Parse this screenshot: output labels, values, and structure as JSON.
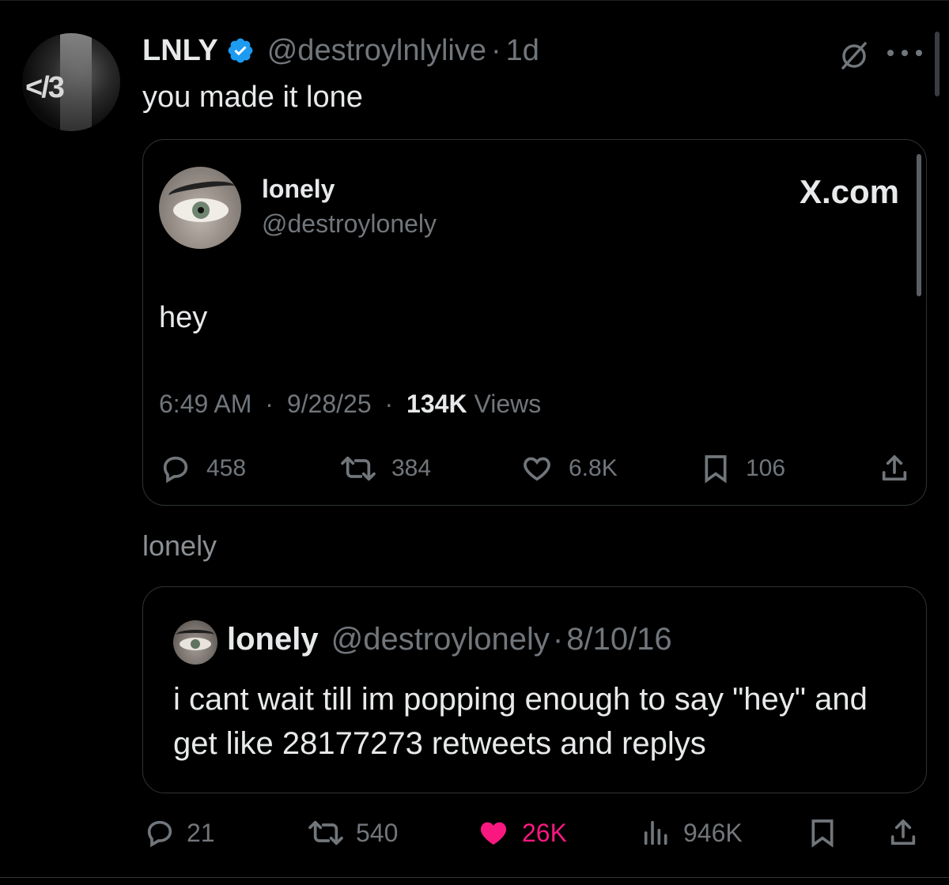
{
  "post": {
    "avatar_text": "</3",
    "author_name": "LNLY",
    "handle": "@destroylnlylive",
    "separator": "·",
    "time": "1d",
    "text": "you made it lone"
  },
  "quote_card": {
    "name": "lonely",
    "handle": "@destroylonely",
    "source": "X.com",
    "text": "hey",
    "time": "6:49 AM",
    "date": "9/28/25",
    "views_count": "134K",
    "views_label": "Views",
    "sep": "·",
    "replies": "458",
    "reposts": "384",
    "likes": "6.8K",
    "bookmarks": "106"
  },
  "label": "lonely",
  "old_quote": {
    "name": "lonely",
    "handle": "@destroylonely",
    "sep": "·",
    "date": "8/10/16",
    "text": "i cant wait till im popping enough to say \"hey\" and get like 28177273 retweets and replys"
  },
  "bottom_actions": {
    "replies": "21",
    "reposts": "540",
    "likes": "26K",
    "views": "946K"
  },
  "colors": {
    "background": "#000000",
    "text": "#e7e9ea",
    "muted": "#71767b",
    "like": "#f91880",
    "verified": "#1d9bf0"
  }
}
